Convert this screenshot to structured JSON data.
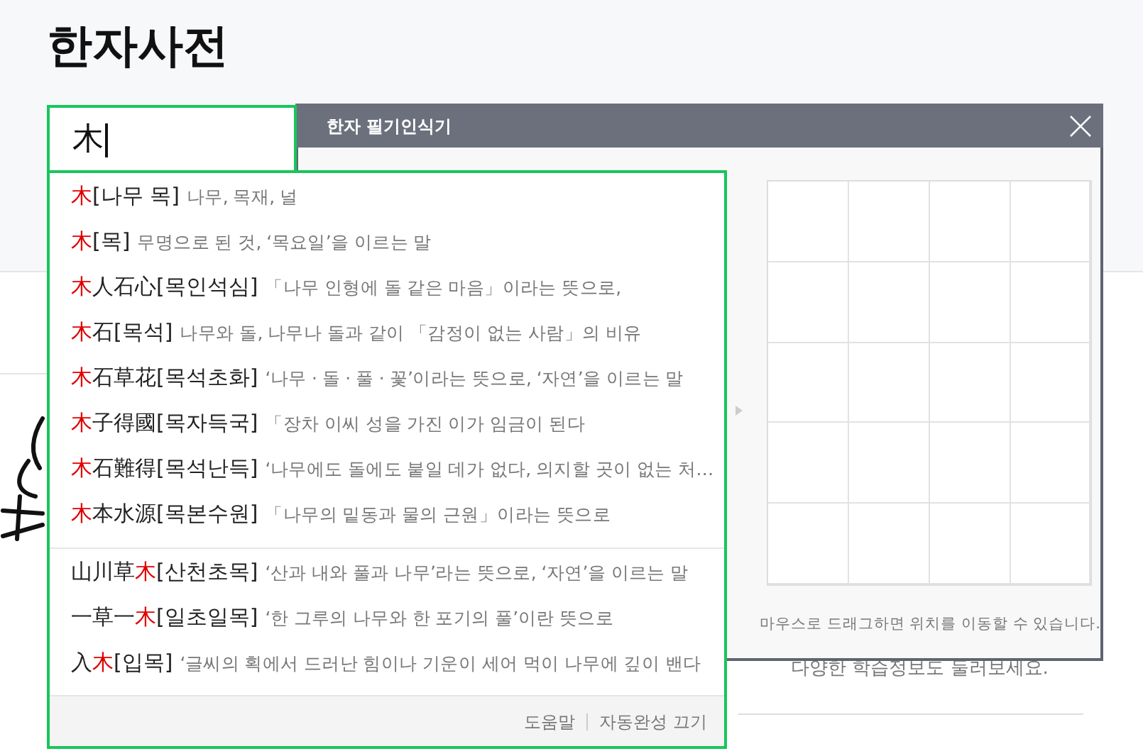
{
  "page_title": "한자사전",
  "search": {
    "value": "木"
  },
  "entries": [
    {
      "parts": [
        {
          "text": "木",
          "match": true
        }
      ],
      "reading": "[나무 목]",
      "description": "나무, 목재, 널"
    },
    {
      "parts": [
        {
          "text": "木",
          "match": true
        }
      ],
      "reading": "[목]",
      "description": "무명으로 된 것, ‘목요일’을 이르는 말"
    },
    {
      "parts": [
        {
          "text": "木",
          "match": true
        },
        {
          "text": "人石心",
          "match": false
        }
      ],
      "reading": "[목인석심]",
      "description": "「나무 인형에 돌 같은 마음」이라는 뜻으로,"
    },
    {
      "parts": [
        {
          "text": "木",
          "match": true
        },
        {
          "text": "石",
          "match": false
        }
      ],
      "reading": "[목석]",
      "description": "나무와 돌, 나무나 돌과 같이 「감정이 없는 사람」의 비유"
    },
    {
      "parts": [
        {
          "text": "木",
          "match": true
        },
        {
          "text": "石草花",
          "match": false
        }
      ],
      "reading": "[목석초화]",
      "description": "‘나무 · 돌 · 풀 · 꽃’이라는 뜻으로, ‘자연’을 이르는 말"
    },
    {
      "parts": [
        {
          "text": "木",
          "match": true
        },
        {
          "text": "子得國",
          "match": false
        }
      ],
      "reading": "[목자득국]",
      "description": "「장차 이씨 성을 가진 이가 임금이 된다"
    },
    {
      "parts": [
        {
          "text": "木",
          "match": true
        },
        {
          "text": "石難得",
          "match": false
        }
      ],
      "reading": "[목석난득]",
      "description": "‘나무에도 돌에도 붙일 데가 없다, 의지할 곳이 없는 처…"
    },
    {
      "parts": [
        {
          "text": "木",
          "match": true
        },
        {
          "text": "本水源",
          "match": false
        }
      ],
      "reading": "[목본수원]",
      "description": "「나무의 밑동과 물의 근원」이라는 뜻으로"
    }
  ],
  "related_entries": [
    {
      "parts": [
        {
          "text": "山川草",
          "match": false
        },
        {
          "text": "木",
          "match": true
        }
      ],
      "reading": "[산천초목]",
      "description": "‘산과 내와 풀과 나무’라는 뜻으로, ‘자연’을 이르는 말"
    },
    {
      "parts": [
        {
          "text": "一草一",
          "match": false
        },
        {
          "text": "木",
          "match": true
        }
      ],
      "reading": "[일초일목]",
      "description": "‘한 그루의 나무와 한 포기의 풀’이란 뜻으로"
    },
    {
      "parts": [
        {
          "text": "入",
          "match": false
        },
        {
          "text": "木",
          "match": true
        }
      ],
      "reading": "[입목]",
      "description": "‘글씨의 획에서 드러난 힘이나 기운이 세어 먹이 나무에 깊이 밴다"
    }
  ],
  "footer_links": [
    "도움말",
    "자동완성 끄기"
  ],
  "handwriting_panel": {
    "title": "한자 필기인식기",
    "hint": "마우스로 드래그하면 위치를 이동할 수 있습니다."
  },
  "background_text": "다양한 학습정보도 둘러보세요."
}
